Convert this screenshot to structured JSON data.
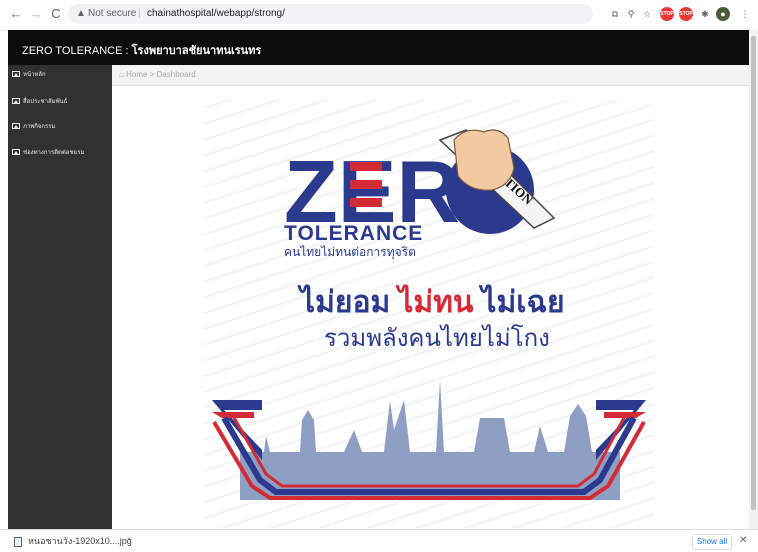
{
  "browser": {
    "back": "←",
    "forward": "→",
    "reload": "C",
    "security_icon": "warning-triangle",
    "security_text": "Not secure",
    "url": "chainathospital/webapp/strong/",
    "extensions": [
      "translate-icon",
      "zoom-icon",
      "star-icon",
      "stop-icon",
      "stop-icon",
      "puzzle-icon",
      "profile-icon",
      "menu-icon"
    ]
  },
  "header": {
    "app_name": "ZERO TOLERANCE : ",
    "hospital_name": "โรงพยาบาลชัยนาทนเรนทร"
  },
  "sidebar": {
    "items": [
      {
        "label": "หน้าหลัก",
        "icon": "image-icon"
      },
      {
        "label": "สื่อประชาสัมพันธ์",
        "icon": "image-icon"
      },
      {
        "label": "ภาพกิจกรรม",
        "icon": "image-icon"
      },
      {
        "label": "ช่องทางการติดต่อชมรม",
        "icon": "image-icon"
      }
    ]
  },
  "breadcrumb": {
    "home_icon": "home-icon",
    "text": "Home > Dashboard"
  },
  "poster": {
    "logo_word": "ZERO",
    "logo_tolerance": "TOLERANCE",
    "logo_thai_tagline": "คนไทยไม่ทนต่อการทุจริต",
    "ribbon_text": "CORRUPTION",
    "slogan_part1": "ไม่ยอม",
    "slogan_part2": "ไม่ทน",
    "slogan_part3": "ไม่เฉย",
    "slogan_line2": "รวมพลังคนไทยไม่โกง",
    "colors": {
      "blue": "#2b3a8c",
      "red": "#d32b36",
      "skyline": "#8f9ec3"
    }
  },
  "download": {
    "filename": "หนอชานวัง-1920x10....jpg",
    "chevron": "^",
    "show_all": "Show all",
    "close": "✕"
  }
}
